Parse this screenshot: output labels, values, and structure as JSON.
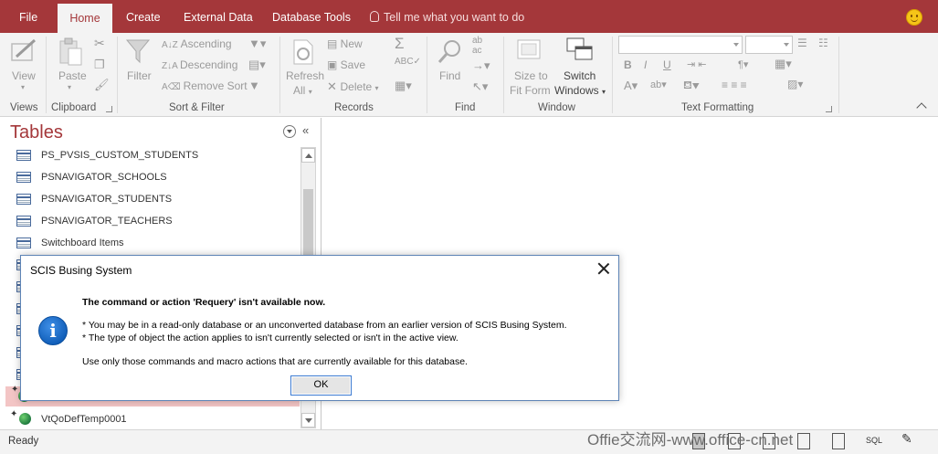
{
  "tabs": [
    "File",
    "Home",
    "Create",
    "External Data",
    "Database Tools"
  ],
  "active_tab": "Home",
  "tell_me": "Tell me what you want to do",
  "ribbon": {
    "views": {
      "view": "View",
      "label": "Views"
    },
    "clipboard": {
      "paste": "Paste",
      "label": "Clipboard"
    },
    "sort_filter": {
      "filter": "Filter",
      "ascending": "Ascending",
      "descending": "Descending",
      "remove_sort": "Remove Sort",
      "label": "Sort & Filter"
    },
    "records": {
      "refresh": "Refresh",
      "all": "All",
      "new": "New",
      "save": "Save",
      "delete": "Delete",
      "label": "Records"
    },
    "find": {
      "find": "Find",
      "label": "Find"
    },
    "window": {
      "size_to": "Size to",
      "fit_form": "Fit Form",
      "switch": "Switch",
      "windows": "Windows",
      "label": "Window"
    },
    "text_formatting": {
      "label": "Text Formatting"
    }
  },
  "nav": {
    "title": "Tables",
    "items": [
      {
        "label": "PS_PVSIS_CUSTOM_STUDENTS",
        "icon": "table-icon"
      },
      {
        "label": "PSNAVIGATOR_SCHOOLS",
        "icon": "table-icon"
      },
      {
        "label": "PSNAVIGATOR_STUDENTS",
        "icon": "table-icon"
      },
      {
        "label": "PSNAVIGATOR_TEACHERS",
        "icon": "table-icon"
      },
      {
        "label": "Switchboard Items",
        "icon": "table-icon"
      }
    ],
    "bottom_item": {
      "label": "VtQoDefTemp0001",
      "icon": "linked-table-icon"
    }
  },
  "dialog": {
    "title": "SCIS Busing System",
    "heading": "The command or action 'Requery' isn't available now.",
    "bullet1": "* You may be in a read-only database or an unconverted database from an earlier version of SCIS Busing System.",
    "bullet2": "* The type of object the action applies to isn't currently selected or isn't in the active view.",
    "footer": "Use only those commands and macro actions that are currently available for this database.",
    "ok": "OK"
  },
  "status": {
    "text": "Ready",
    "sql": "SQL"
  },
  "watermark": "Offie交流网-www.office-cn.net",
  "colors": {
    "accent": "#a4373a",
    "dialog_border": "#5e84b6",
    "info_icon": "#0f5db8"
  }
}
